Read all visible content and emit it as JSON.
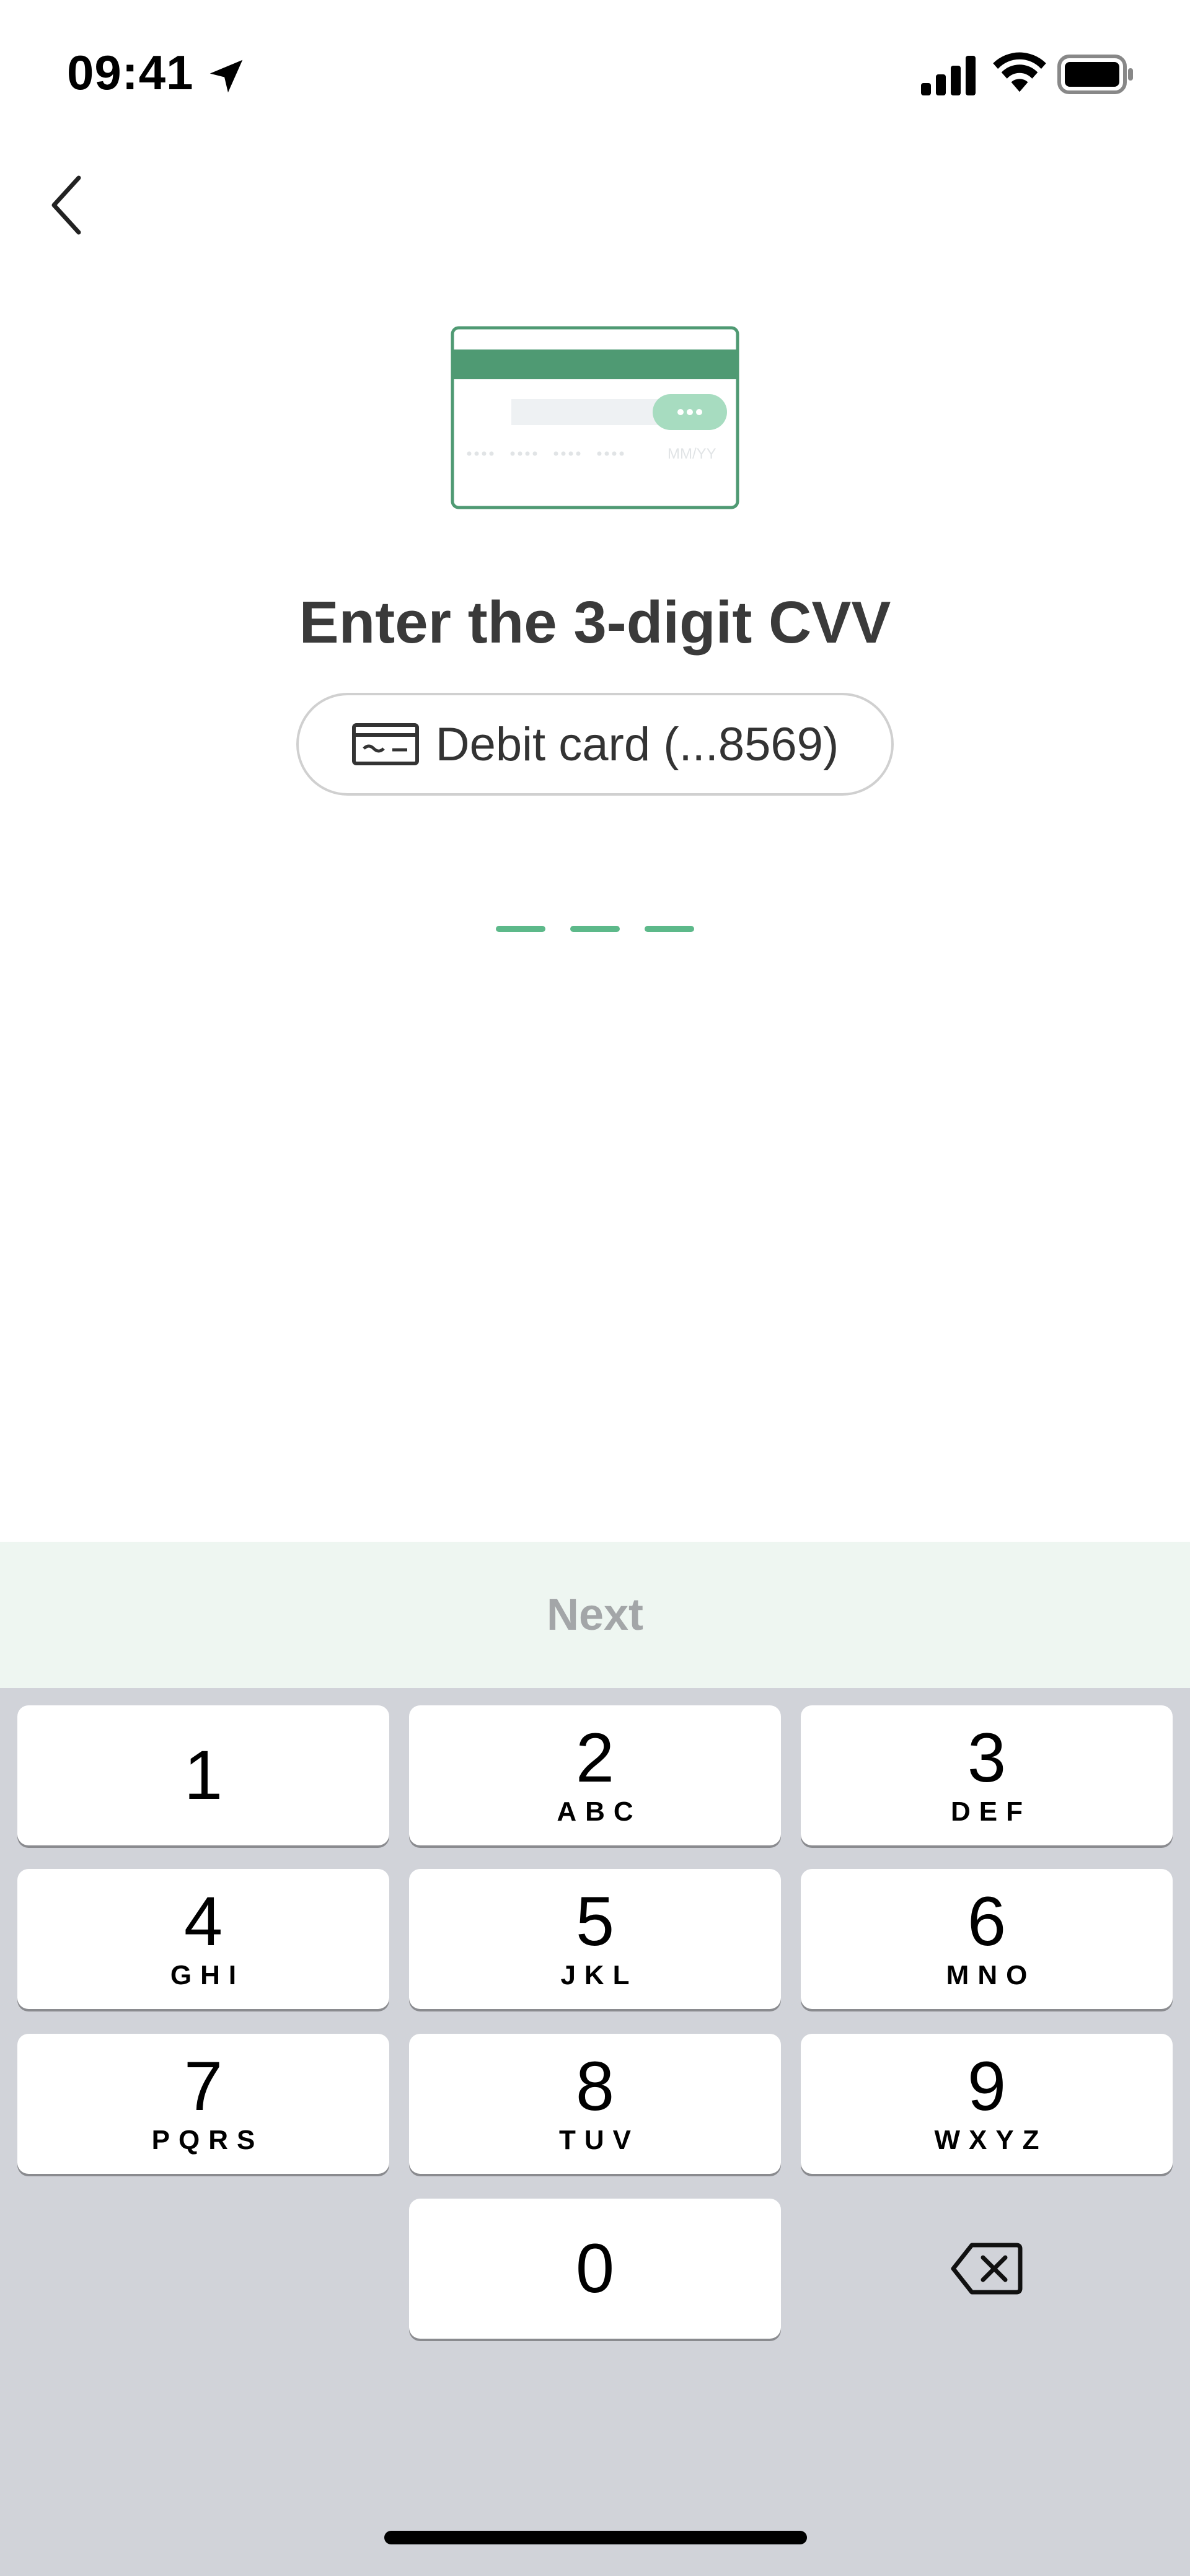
{
  "status_bar": {
    "time": "09:41",
    "icons": [
      "location-arrow-icon",
      "cellular-signal-icon",
      "wifi-icon",
      "battery-icon"
    ]
  },
  "nav": {
    "back_icon": "chevron-left-icon"
  },
  "illustration": {
    "name": "card-back-cvv-illustration",
    "expiry_hint": "MM/YY",
    "accent": "#4f9a73"
  },
  "headline": "Enter the 3-digit CVV",
  "card_selector": {
    "icon": "credit-card-icon",
    "label": "Debit card (...8569)"
  },
  "cvv": {
    "length": 3,
    "value": "",
    "slot_color": "#5db98a"
  },
  "next_button": {
    "label": "Next",
    "enabled": false,
    "background": "#eef6f1"
  },
  "keypad": {
    "keys": [
      {
        "digit": "1",
        "letters": ""
      },
      {
        "digit": "2",
        "letters": "ABC"
      },
      {
        "digit": "3",
        "letters": "DEF"
      },
      {
        "digit": "4",
        "letters": "GHI"
      },
      {
        "digit": "5",
        "letters": "JKL"
      },
      {
        "digit": "6",
        "letters": "MNO"
      },
      {
        "digit": "7",
        "letters": "PQRS"
      },
      {
        "digit": "8",
        "letters": "TUV"
      },
      {
        "digit": "9",
        "letters": "WXYZ"
      },
      {
        "digit": "0",
        "letters": ""
      }
    ],
    "delete_icon": "backspace-icon",
    "background": "#d1d3d9"
  }
}
